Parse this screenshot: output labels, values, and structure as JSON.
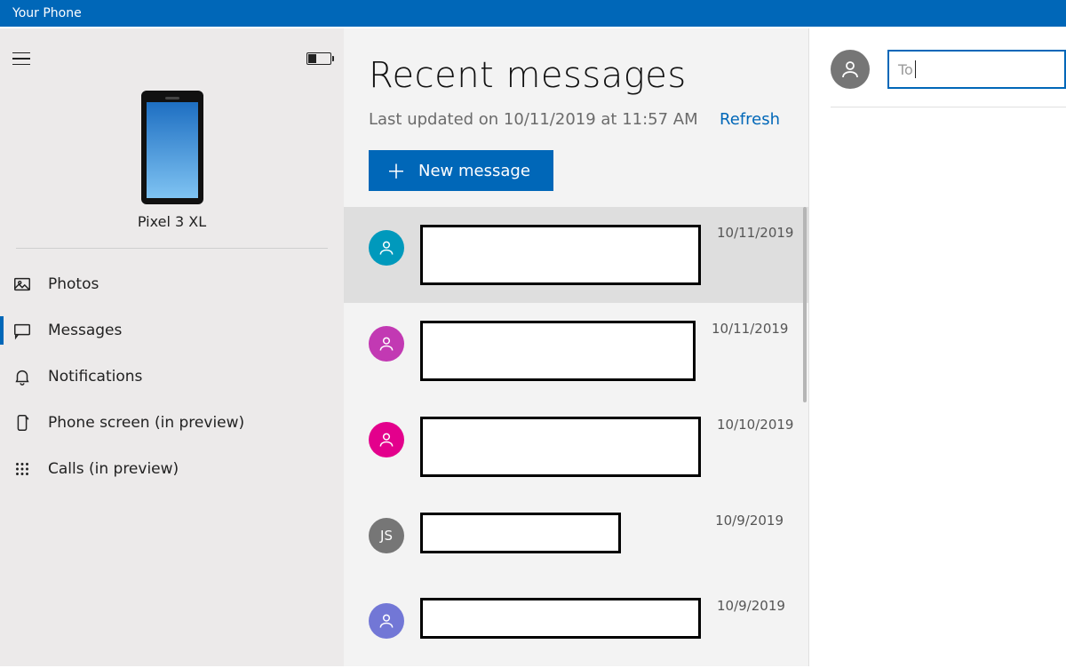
{
  "titlebar": {
    "title": "Your Phone"
  },
  "sidebar": {
    "device_name": "Pixel 3 XL",
    "nav": [
      {
        "id": "photos",
        "label": "Photos",
        "icon": "image-icon",
        "active": false
      },
      {
        "id": "messages",
        "label": "Messages",
        "icon": "chat-icon",
        "active": true
      },
      {
        "id": "notifications",
        "label": "Notifications",
        "icon": "bell-icon",
        "active": false
      },
      {
        "id": "phone-screen",
        "label": "Phone screen (in preview)",
        "icon": "phone-mirror-icon",
        "active": false
      },
      {
        "id": "calls",
        "label": "Calls (in preview)",
        "icon": "dialpad-icon",
        "active": false
      }
    ]
  },
  "messages_panel": {
    "title": "Recent messages",
    "last_updated": "Last updated on 10/11/2019 at 11:57 AM",
    "refresh_label": "Refresh",
    "new_message_label": "New message",
    "items": [
      {
        "avatar_color": "#0099bc",
        "avatar_text": "",
        "date": "10/11/2019",
        "selected": true,
        "redact_w": 316,
        "redact_h": 68
      },
      {
        "avatar_color": "#c239b3",
        "avatar_text": "",
        "date": "10/11/2019",
        "selected": false,
        "redact_w": 310,
        "redact_h": 68
      },
      {
        "avatar_color": "#e3008c",
        "avatar_text": "",
        "date": "10/10/2019",
        "selected": false,
        "redact_w": 316,
        "redact_h": 68
      },
      {
        "avatar_color": "#767676",
        "avatar_text": "JS",
        "date": "10/9/2019",
        "selected": false,
        "redact_w": 226,
        "redact_h": 46
      },
      {
        "avatar_color": "#7277d6",
        "avatar_text": "",
        "date": "10/9/2019",
        "selected": false,
        "redact_w": 316,
        "redact_h": 46
      }
    ]
  },
  "compose": {
    "to_placeholder": "To"
  }
}
